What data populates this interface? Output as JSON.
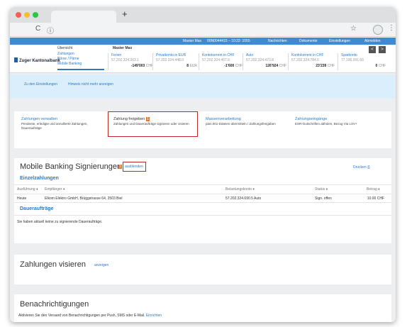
{
  "browser": {
    "new_tab_symbol": "+",
    "back_symbol": "C",
    "info_symbol": "ⓘ",
    "star_symbol": "☆",
    "menu_symbol": "⋮"
  },
  "topbar": {
    "user": "Master Max",
    "id": "00N0044415 – 10:22: 1055",
    "messages": "Nachrichten",
    "documents": "Dokumente",
    "settings": "Einstellungen",
    "logout": "Abmelden"
  },
  "bank": {
    "name": "Zuger Kantonalbank"
  },
  "overview": {
    "heading": "Übersicht",
    "links": [
      "Zahlungen",
      "Börse / Pärne",
      "Mobile Banking"
    ]
  },
  "accounts": {
    "owner": "Master Max",
    "items": [
      {
        "name": "Ferien",
        "number": "57.202.324.363.1",
        "balance": "-149'003",
        "currency": "CHF"
      },
      {
        "name": "Privatkonto in EUR",
        "number": "57.202.324.448.0",
        "balance": "8",
        "currency": "EUR"
      },
      {
        "name": "Kontokorrent in CHF",
        "number": "57.202.324.467.6",
        "balance": "-1'600",
        "currency": "CHF"
      },
      {
        "name": "Auto",
        "number": "57.202.324.473.8",
        "balance": "126'924",
        "currency": "CHF"
      },
      {
        "name": "Kontokorrent in CHF",
        "number": "57.202.324.784.5",
        "balance": "23'239",
        "currency": "CHF"
      },
      {
        "name": "Sparkonto",
        "number": "77.196.391.66",
        "balance": "0",
        "currency": "CHF"
      }
    ],
    "prev": "<",
    "next": ">"
  },
  "infobar": {
    "settings_link": "Zu den Einstellungen",
    "hide_link": "Hinweis nicht mehr anzeigen"
  },
  "quicklinks": [
    {
      "title": "Zahlungen verwalten",
      "desc": "Pendente, erledigte und annullierte Zahlungen, Daueraufträge"
    },
    {
      "title": "Zahlung freigeben",
      "badge": "1",
      "desc": "Zahlungen und Daueraufträge signieren oder visieren"
    },
    {
      "title": "Massenverarbeitung",
      "desc": "pain.001-Dateien übermitteln / Zahlungsfreigaben"
    },
    {
      "title": "Zahlungseingänge",
      "desc": "ESR-Gutschriften abholen, Bezug Via LSV+"
    }
  ],
  "signing": {
    "title": "Mobile Banking Signierungen",
    "badge": "1",
    "hide_link": "ausblenden",
    "print": "Drucken",
    "single_heading": "Einzelzahlungen",
    "columns": [
      "Ausführung ♦",
      "Empfänger ♦",
      "Belastungskonto ♦",
      "Status ♦",
      "Betrag ♦"
    ],
    "rows": [
      {
        "date": "Heute",
        "recipient": "Elkom Elektro GmbH, Brüggstrasse 64, 2503 Biel",
        "account": "57.202.324.690.5 Auto",
        "status": "Sign. offen",
        "amount": "10.00 CHF"
      }
    ],
    "standing_heading": "Daueraufträge",
    "standing_empty": "Sie haben aktuell keine zu signierende Daueraufträge."
  },
  "visieren": {
    "title": "Zahlungen visieren",
    "show_link": "anzeigen"
  },
  "notifications": {
    "title": "Benachrichtigungen",
    "text": "Aktivieren Sie den Versand von Benachrichtigungen per Push, SMS oder E-Mail.",
    "link": "Einrichten"
  },
  "colors": {
    "accent": "#2a7bc4",
    "highlight": "#c0282c",
    "badge": "#e8762b"
  }
}
